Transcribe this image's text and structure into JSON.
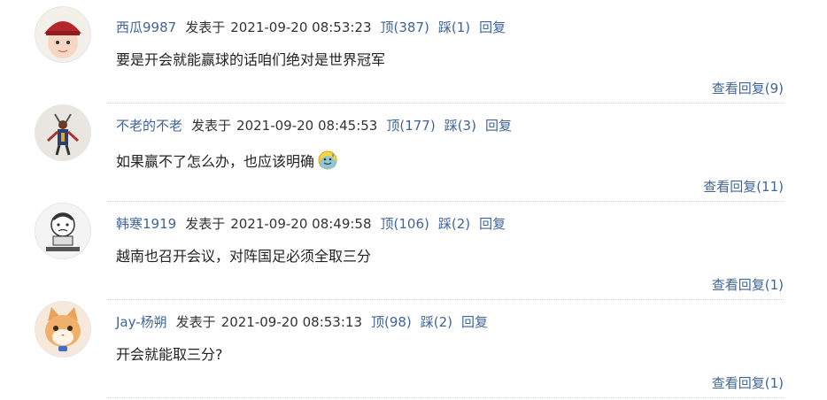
{
  "comments": [
    {
      "username": "西瓜9987",
      "posted_label": "发表于",
      "timestamp": "2021-09-20 08:53:23",
      "upvote": "顶(387)",
      "downvote": "踩(1)",
      "reply": "回复",
      "text": "要是开会就能赢球的话咱们绝对是世界冠军",
      "view_replies": "查看回复(9)"
    },
    {
      "username": "不老的不老",
      "posted_label": "发表于",
      "timestamp": "2021-09-20 08:45:53",
      "upvote": "顶(177)",
      "downvote": "踩(3)",
      "reply": "回复",
      "text": "如果赢不了怎么办，也应该明确",
      "view_replies": "查看回复(11)"
    },
    {
      "username": "韩寒1919",
      "posted_label": "发表于",
      "timestamp": "2021-09-20 08:49:58",
      "upvote": "顶(106)",
      "downvote": "踩(2)",
      "reply": "回复",
      "text": "越南也召开会议，对阵国足必须全取三分",
      "view_replies": "查看回复(1)"
    },
    {
      "username": "Jay-杨朔",
      "posted_label": "发表于",
      "timestamp": "2021-09-20 08:53:13",
      "upvote": "顶(98)",
      "downvote": "踩(2)",
      "reply": "回复",
      "text": "开会就能取三分?",
      "view_replies": "查看回复(1)"
    }
  ],
  "colors": {
    "link": "#406599",
    "text": "#222222",
    "divider": "#cfd6df"
  },
  "icons": {
    "emoji": "sweat-smile-emoji-icon"
  }
}
